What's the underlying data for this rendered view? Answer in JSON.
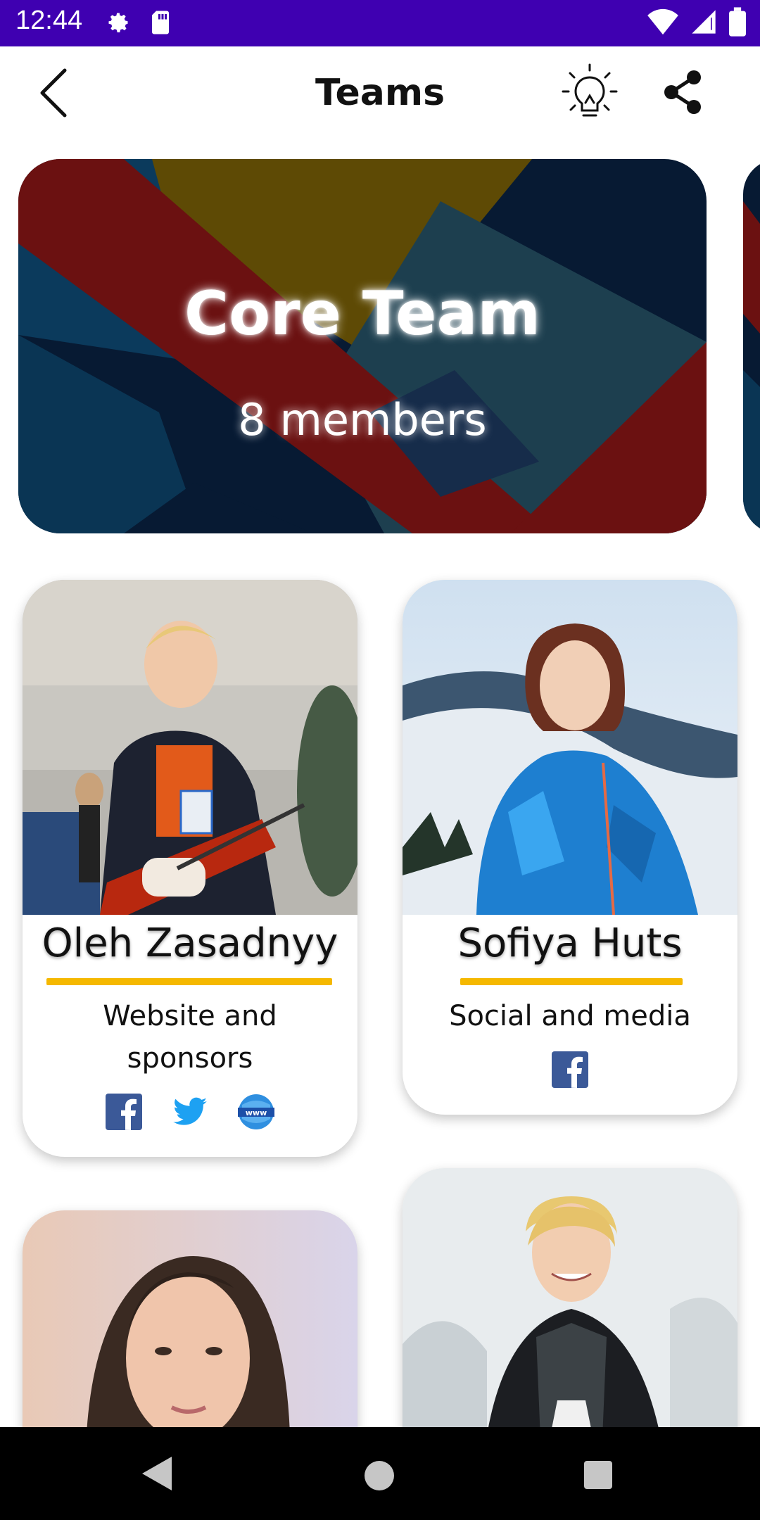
{
  "status_bar": {
    "time": "12:44",
    "left_icons": [
      "gear-icon",
      "sd-card-icon"
    ],
    "right_icons": [
      "wifi-icon",
      "signal-icon",
      "battery-icon"
    ]
  },
  "app_bar": {
    "title": "Teams",
    "icons": [
      "back-arrow-icon",
      "lightbulb-icon",
      "share-icon"
    ]
  },
  "team": {
    "name": "Core Team",
    "members": "8 members"
  },
  "members": [
    {
      "name": "Oleh Zasadnyy",
      "role": "Website and sponsors",
      "socials": [
        "facebook-icon",
        "twitter-icon",
        "website-icon"
      ]
    },
    {
      "name": "Sofiya Huts",
      "role": "Social and media",
      "socials": [
        "facebook-icon"
      ]
    }
  ],
  "nav_bar": {
    "icons": [
      "nav-back-icon",
      "nav-home-icon",
      "nav-recents-icon"
    ]
  },
  "colors": {
    "status_bar": "#3f00b1",
    "accent_underline": "#f5b800",
    "facebook": "#3b5998",
    "twitter": "#1da1f2"
  }
}
